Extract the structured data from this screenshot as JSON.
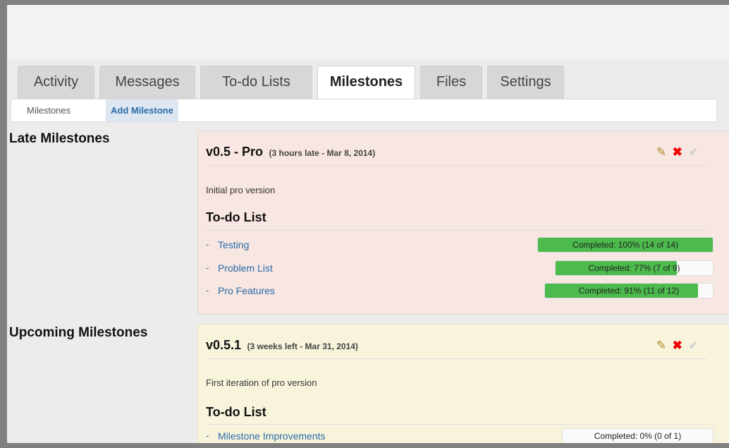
{
  "tabs": [
    {
      "label": "Activity",
      "active": false
    },
    {
      "label": "Messages",
      "active": false
    },
    {
      "label": "To-do Lists",
      "active": false
    },
    {
      "label": "Milestones",
      "active": true
    },
    {
      "label": "Files",
      "active": false
    },
    {
      "label": "Settings",
      "active": false
    }
  ],
  "subnav": {
    "milestones": "Milestones",
    "add": "Add Milestone"
  },
  "late": {
    "section_title": "Late Milestones",
    "milestone": {
      "name": "v0.5 - Pro",
      "status": "(3 hours late - Mar 8, 2014)",
      "description": "Initial pro version",
      "todo_title": "To-do List",
      "actions": {
        "edit_icon": "pencil-icon",
        "delete_icon": "x-icon",
        "complete_icon": "check-icon"
      },
      "todos": [
        {
          "dash": "-",
          "name": "Testing",
          "progress_label": "Completed: 100% (14 of 14)",
          "progress": 1.0
        },
        {
          "dash": "-",
          "name": "Problem List",
          "progress_label": "Completed: 77% (7 of 9)",
          "progress": 0.77
        },
        {
          "dash": "-",
          "name": "Pro Features",
          "progress_label": "Completed: 91% (11 of 12)",
          "progress": 0.91
        }
      ]
    }
  },
  "upcoming": {
    "section_title": "Upcoming Milestones",
    "milestone": {
      "name": "v0.5.1",
      "status": "(3 weeks left - Mar 31, 2014)",
      "description": "First iteration of pro version",
      "todo_title": "To-do List",
      "todos": [
        {
          "dash": "-",
          "name": "Milestone Improvements",
          "progress_label": "Completed: 0% (0 of 1)",
          "progress": 0.0
        }
      ]
    }
  },
  "colors": {
    "late_bg": "#f8e6e2",
    "upcoming_bg": "#f8f4dc",
    "progress": "#4cba4c",
    "link": "#2a6ba8"
  }
}
